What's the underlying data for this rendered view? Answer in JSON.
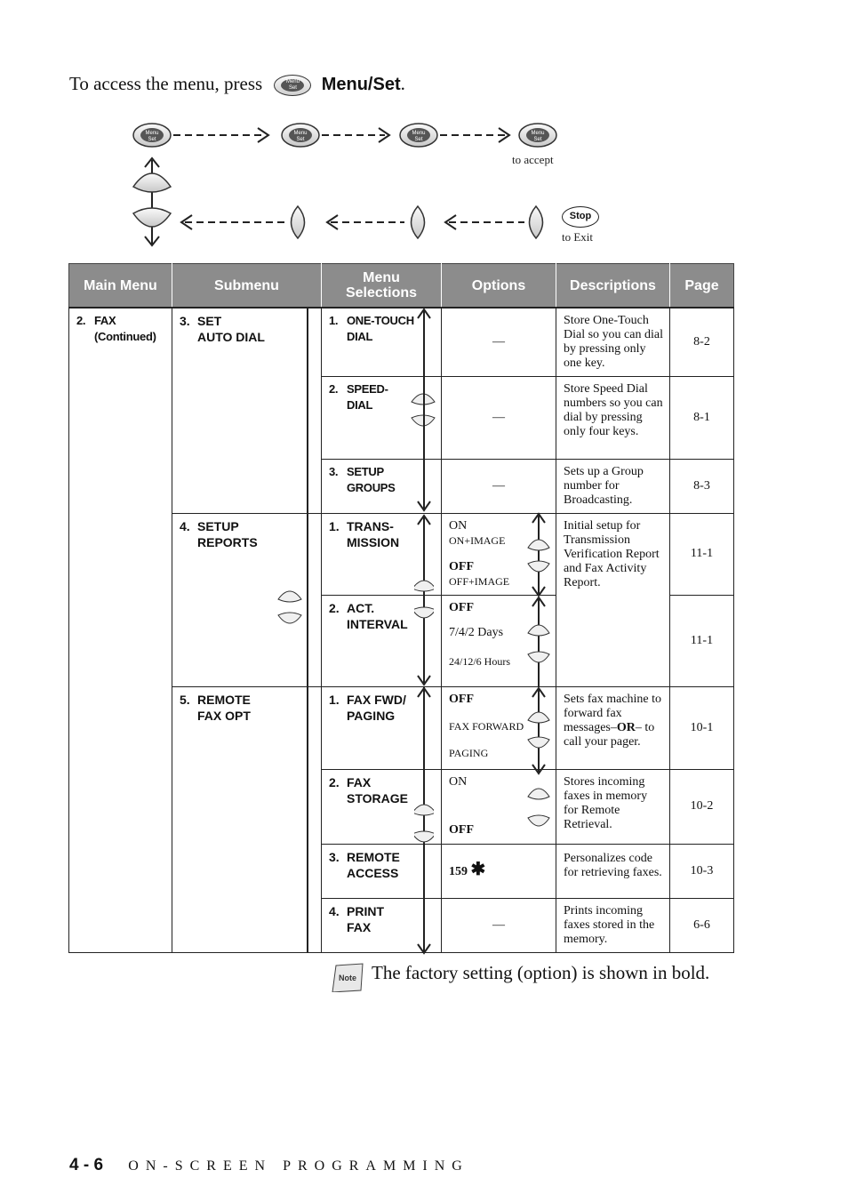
{
  "intro": {
    "prefix": "To access the menu, press",
    "button_label": "Menu/Set",
    "suffix": "."
  },
  "nav_diagram": {
    "menu_button_top": "Menu",
    "menu_button_bottom": "Set",
    "accept_label": "to accept",
    "stop_label": "Stop",
    "exit_label": "to Exit"
  },
  "table": {
    "headers": [
      "Main Menu",
      "Submenu",
      "Menu Selections",
      "Options",
      "Descriptions",
      "Page"
    ],
    "main_menu": {
      "number": "2.",
      "label": "FAX",
      "sub": "(Continued)"
    },
    "submenus": [
      {
        "number": "3.",
        "line1": "SET",
        "line2": "AUTO DIAL",
        "selections": [
          {
            "number": "1.",
            "line1": "ONE-TOUCH",
            "line2": "DIAL",
            "options": "—",
            "description": "Store One-Touch Dial so you can dial by pressing only one key.",
            "page": "8-2"
          },
          {
            "number": "2.",
            "line1": "SPEED-",
            "line2": "DIAL",
            "options": "—",
            "description": "Store Speed Dial numbers so you can dial by pressing only four keys.",
            "page": "8-1"
          },
          {
            "number": "3.",
            "line1": "SETUP",
            "line2": "GROUPS",
            "options": "—",
            "description": "Sets up a Group number for Broadcasting.",
            "page": "8-3"
          }
        ]
      },
      {
        "number": "4.",
        "line1": "SETUP",
        "line2": "REPORTS",
        "selections": [
          {
            "number": "1.",
            "line1": "TRANS-",
            "line2": "MISSION",
            "options": [
              "ON",
              "ON+IMAGE",
              "OFF",
              "OFF+IMAGE"
            ],
            "default_option": "OFF",
            "description": "Initial setup for Transmission Verification Report and Fax Activity Report.",
            "page": "11-1"
          },
          {
            "number": "2.",
            "line1": "ACT.",
            "line2": "INTERVAL",
            "options": [
              "OFF",
              "7/4/2 Days",
              "24/12/6 Hours"
            ],
            "default_option": "OFF",
            "description": "",
            "page": "11-1"
          }
        ]
      },
      {
        "number": "5.",
        "line1": "REMOTE",
        "line2": "FAX OPT",
        "selections": [
          {
            "number": "1.",
            "line1": "FAX FWD/",
            "line2": "PAGING",
            "options": [
              "OFF",
              "FAX FORWARD",
              "PAGING"
            ],
            "default_option": "OFF",
            "description_parts": [
              "Sets fax machine to forward fax messages–",
              "OR",
              "– to call your pager."
            ],
            "page": "10-1"
          },
          {
            "number": "2.",
            "line1": "FAX",
            "line2": "STORAGE",
            "options": [
              "ON",
              "OFF"
            ],
            "default_option": "OFF",
            "description": "Stores incoming faxes in memory for Remote Retrieval.",
            "page": "10-2"
          },
          {
            "number": "3.",
            "line1": "REMOTE",
            "line2": "ACCESS",
            "options": [
              "159 ✱"
            ],
            "option_text": "159",
            "description": "Personalizes code for retrieving faxes.",
            "page": "10-3"
          },
          {
            "number": "4.",
            "line1": "PRINT",
            "line2": "FAX",
            "options": "—",
            "description": "Prints incoming faxes stored in the memory.",
            "page": "6-6"
          }
        ]
      }
    ]
  },
  "note": {
    "icon_label": "Note",
    "text": "The factory setting (option) is shown in bold."
  },
  "footer": {
    "page_number": "4 - 6",
    "section": "ON-SCREEN PROGRAMMING"
  }
}
